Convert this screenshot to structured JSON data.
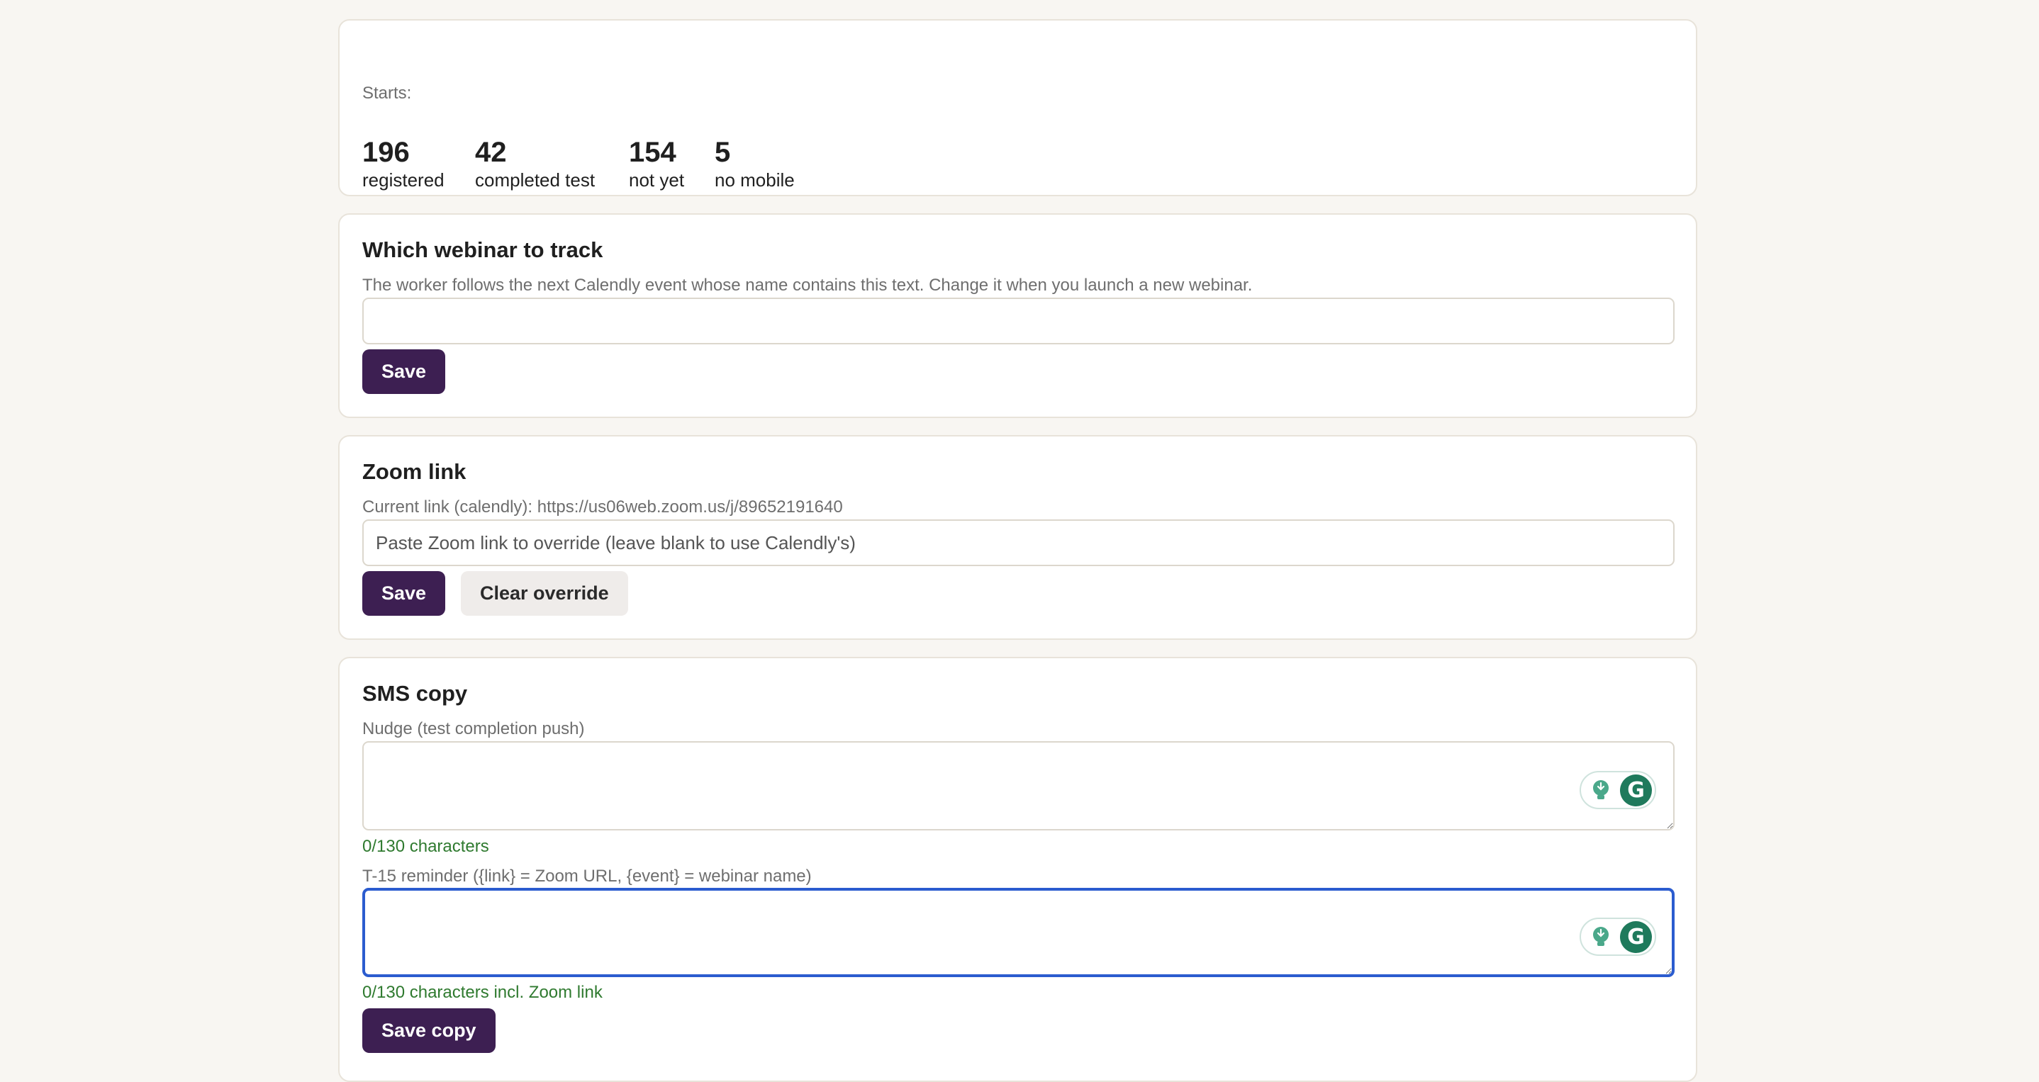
{
  "stats": {
    "starts_label": "Starts:",
    "items": [
      {
        "value": "196",
        "label": "registered"
      },
      {
        "value": "42",
        "label": "completed test"
      },
      {
        "value": "154",
        "label": "not yet"
      },
      {
        "value": "5",
        "label": "no mobile"
      }
    ]
  },
  "webinar": {
    "title": "Which webinar to track",
    "description": "The worker follows the next Calendly event whose name contains this text. Change it when you launch a new webinar.",
    "input_value": "",
    "save_label": "Save"
  },
  "zoom": {
    "title": "Zoom link",
    "current_link": "Current link (calendly): https://us06web.zoom.us/j/89652191640",
    "placeholder": "Paste Zoom link to override (leave blank to use Calendly's)",
    "save_label": "Save",
    "clear_label": "Clear override"
  },
  "sms": {
    "title": "SMS copy",
    "nudge_label": "Nudge (test completion push)",
    "nudge_value": "",
    "nudge_counter": "0/130 characters",
    "reminder_label": "T-15 reminder ({link} = Zoom URL, {event} = webinar name)",
    "reminder_value": "",
    "reminder_counter": "0/130 characters incl. Zoom link",
    "save_label": "Save copy"
  },
  "colors": {
    "primary_button": "#3d1f52",
    "focus_border": "#2b5ccf",
    "counter_text": "#2f7a2f",
    "assistant_icon": "#1f7a5c"
  },
  "icons": {
    "assistant_bulb": "lightbulb-icon",
    "assistant_logo": "grammarly-g-icon"
  }
}
